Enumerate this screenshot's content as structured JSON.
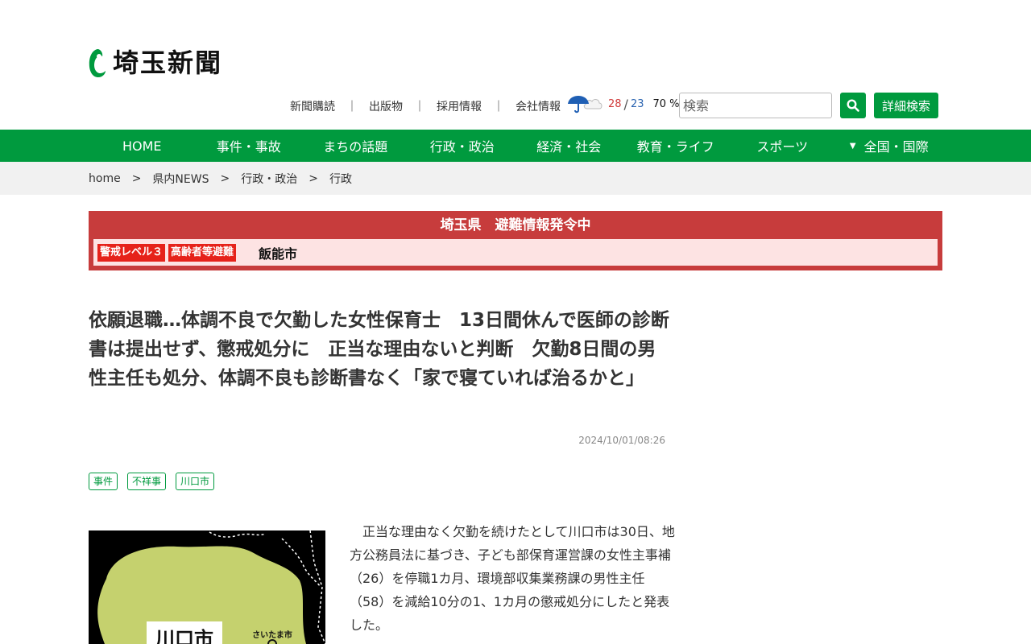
{
  "header": {
    "logo_text": "埼玉新聞",
    "util_links": [
      "新聞購読",
      "出版物",
      "採用情報",
      "会社情報"
    ],
    "separator": "｜",
    "weather": {
      "icon": "umbrella-cloud-icon",
      "high": "28",
      "low": "23",
      "humidity": "70 %"
    },
    "search": {
      "placeholder": "検索",
      "value": ""
    },
    "advanced_search_label": "詳細検索"
  },
  "nav": {
    "items": [
      "HOME",
      "事件・事故",
      "まちの話題",
      "行政・政治",
      "経済・社会",
      "教育・ライフ",
      "スポーツ",
      "全国・国際"
    ],
    "caret": "▼"
  },
  "breadcrumb": {
    "items": [
      "home",
      "県内NEWS",
      "行政・政治",
      "行政"
    ],
    "sep": ">"
  },
  "alert": {
    "title": "埼玉県　避難情報発令中",
    "badges": [
      "警戒レベル３",
      "高齢者等避難"
    ],
    "city": "飯能市"
  },
  "article": {
    "headline": "依願退職…体調不良で欠勤した女性保育士　13日間休んで医師の診断書は提出せず、懲戒処分に　正当な理由ないと判断　欠勤8日間の男性主任も処分、体調不良も診断書なく「家で寝ていれば治るかと」",
    "date": "2024/10/01/08:26",
    "tags": [
      "事件",
      "不祥事",
      "川口市"
    ],
    "map_labels": {
      "main": "川口市",
      "sub": "さいたま市"
    },
    "body": "　正当な理由なく欠勤を続けたとして川口市は30日、地方公務員法に基づき、子ども部保育運営課の女性主事補（26）を停職1カ月、環境部収集業務課の男性主任（58）を減給10分の1、1カ月の懲戒処分にしたと発表した。"
  },
  "colors": {
    "brand_green": "#009a3e",
    "alert_red": "#c73c3c",
    "badge_red": "#e6221a"
  }
}
